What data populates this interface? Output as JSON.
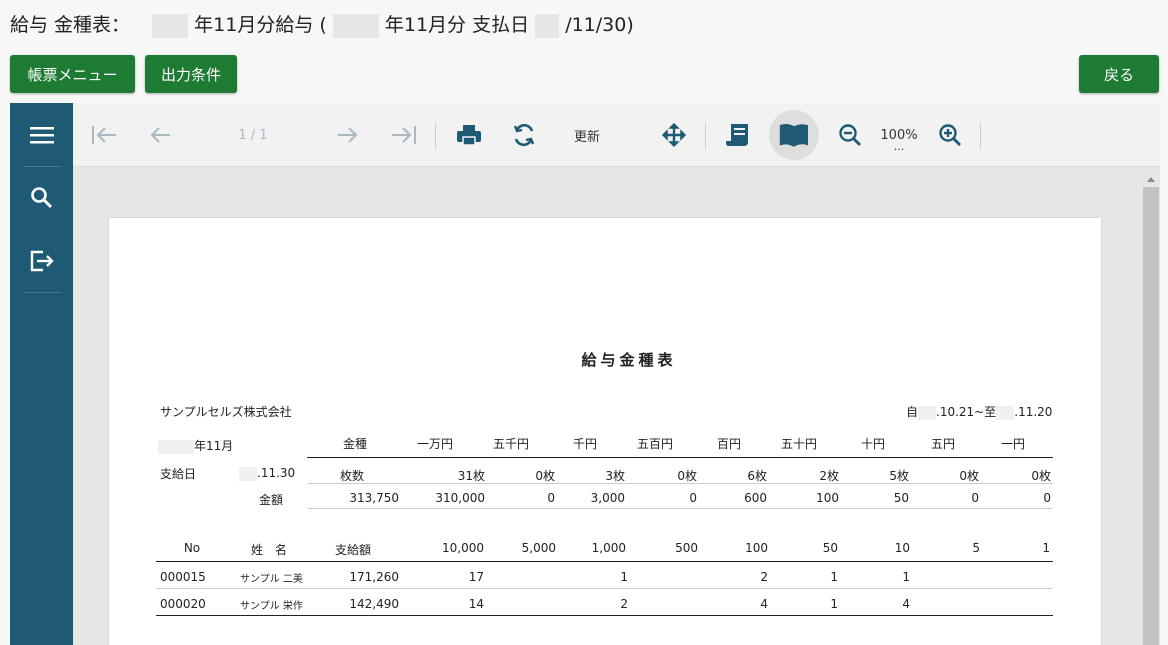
{
  "title": {
    "prefix": "給与 金種表：",
    "part1": "年11月分給与 (",
    "part2": "年11月分 支払日",
    "part3": "/11/30)"
  },
  "buttons": {
    "menu": "帳票メニュー",
    "output": "出力条件",
    "back": "戻る"
  },
  "toolbar": {
    "page_indicator": "1 / 1",
    "refresh": "更新",
    "zoom": "100%",
    "zoom_more": "..."
  },
  "report": {
    "title": "給与金種表",
    "company": "サンプルセルズ株式会社",
    "period_from": "自",
    "period_from_date": ".10.21~至",
    "period_to_date": ".11.20",
    "month_label": "年11月",
    "payday_label": "支給日",
    "payday_date": ".11.30",
    "summary_headers": [
      "金種",
      "一万円",
      "五千円",
      "千円",
      "五百円",
      "百円",
      "五十円",
      "十円",
      "五円",
      "一円"
    ],
    "count_label": "枚数",
    "counts": [
      "31枚",
      "0枚",
      "3枚",
      "0枚",
      "6枚",
      "2枚",
      "5枚",
      "0枚",
      "0枚"
    ],
    "amount_label": "金額",
    "amount_total": "313,750",
    "amounts": [
      "310,000",
      "0",
      "3,000",
      "0",
      "600",
      "100",
      "50",
      "0",
      "0"
    ],
    "detail_headers": [
      "No",
      "姓　名",
      "支給額",
      "10,000",
      "5,000",
      "1,000",
      "500",
      "100",
      "50",
      "10",
      "5",
      "1"
    ],
    "rows": [
      {
        "no": "000015",
        "name": "サンプル 二美",
        "pay": "171,260",
        "c10000": "17",
        "c5000": "",
        "c1000": "1",
        "c500": "",
        "c100": "2",
        "c50": "1",
        "c10": "1",
        "c5": "",
        "c1": ""
      },
      {
        "no": "000020",
        "name": "サンプル 栄作",
        "pay": "142,490",
        "c10000": "14",
        "c5000": "",
        "c1000": "2",
        "c500": "",
        "c100": "4",
        "c50": "1",
        "c10": "4",
        "c5": "",
        "c1": ""
      }
    ]
  },
  "colors": {
    "accent_green": "#1e7b34",
    "sidebar": "#1e5a73",
    "icon_dark": "#1e5a73"
  }
}
